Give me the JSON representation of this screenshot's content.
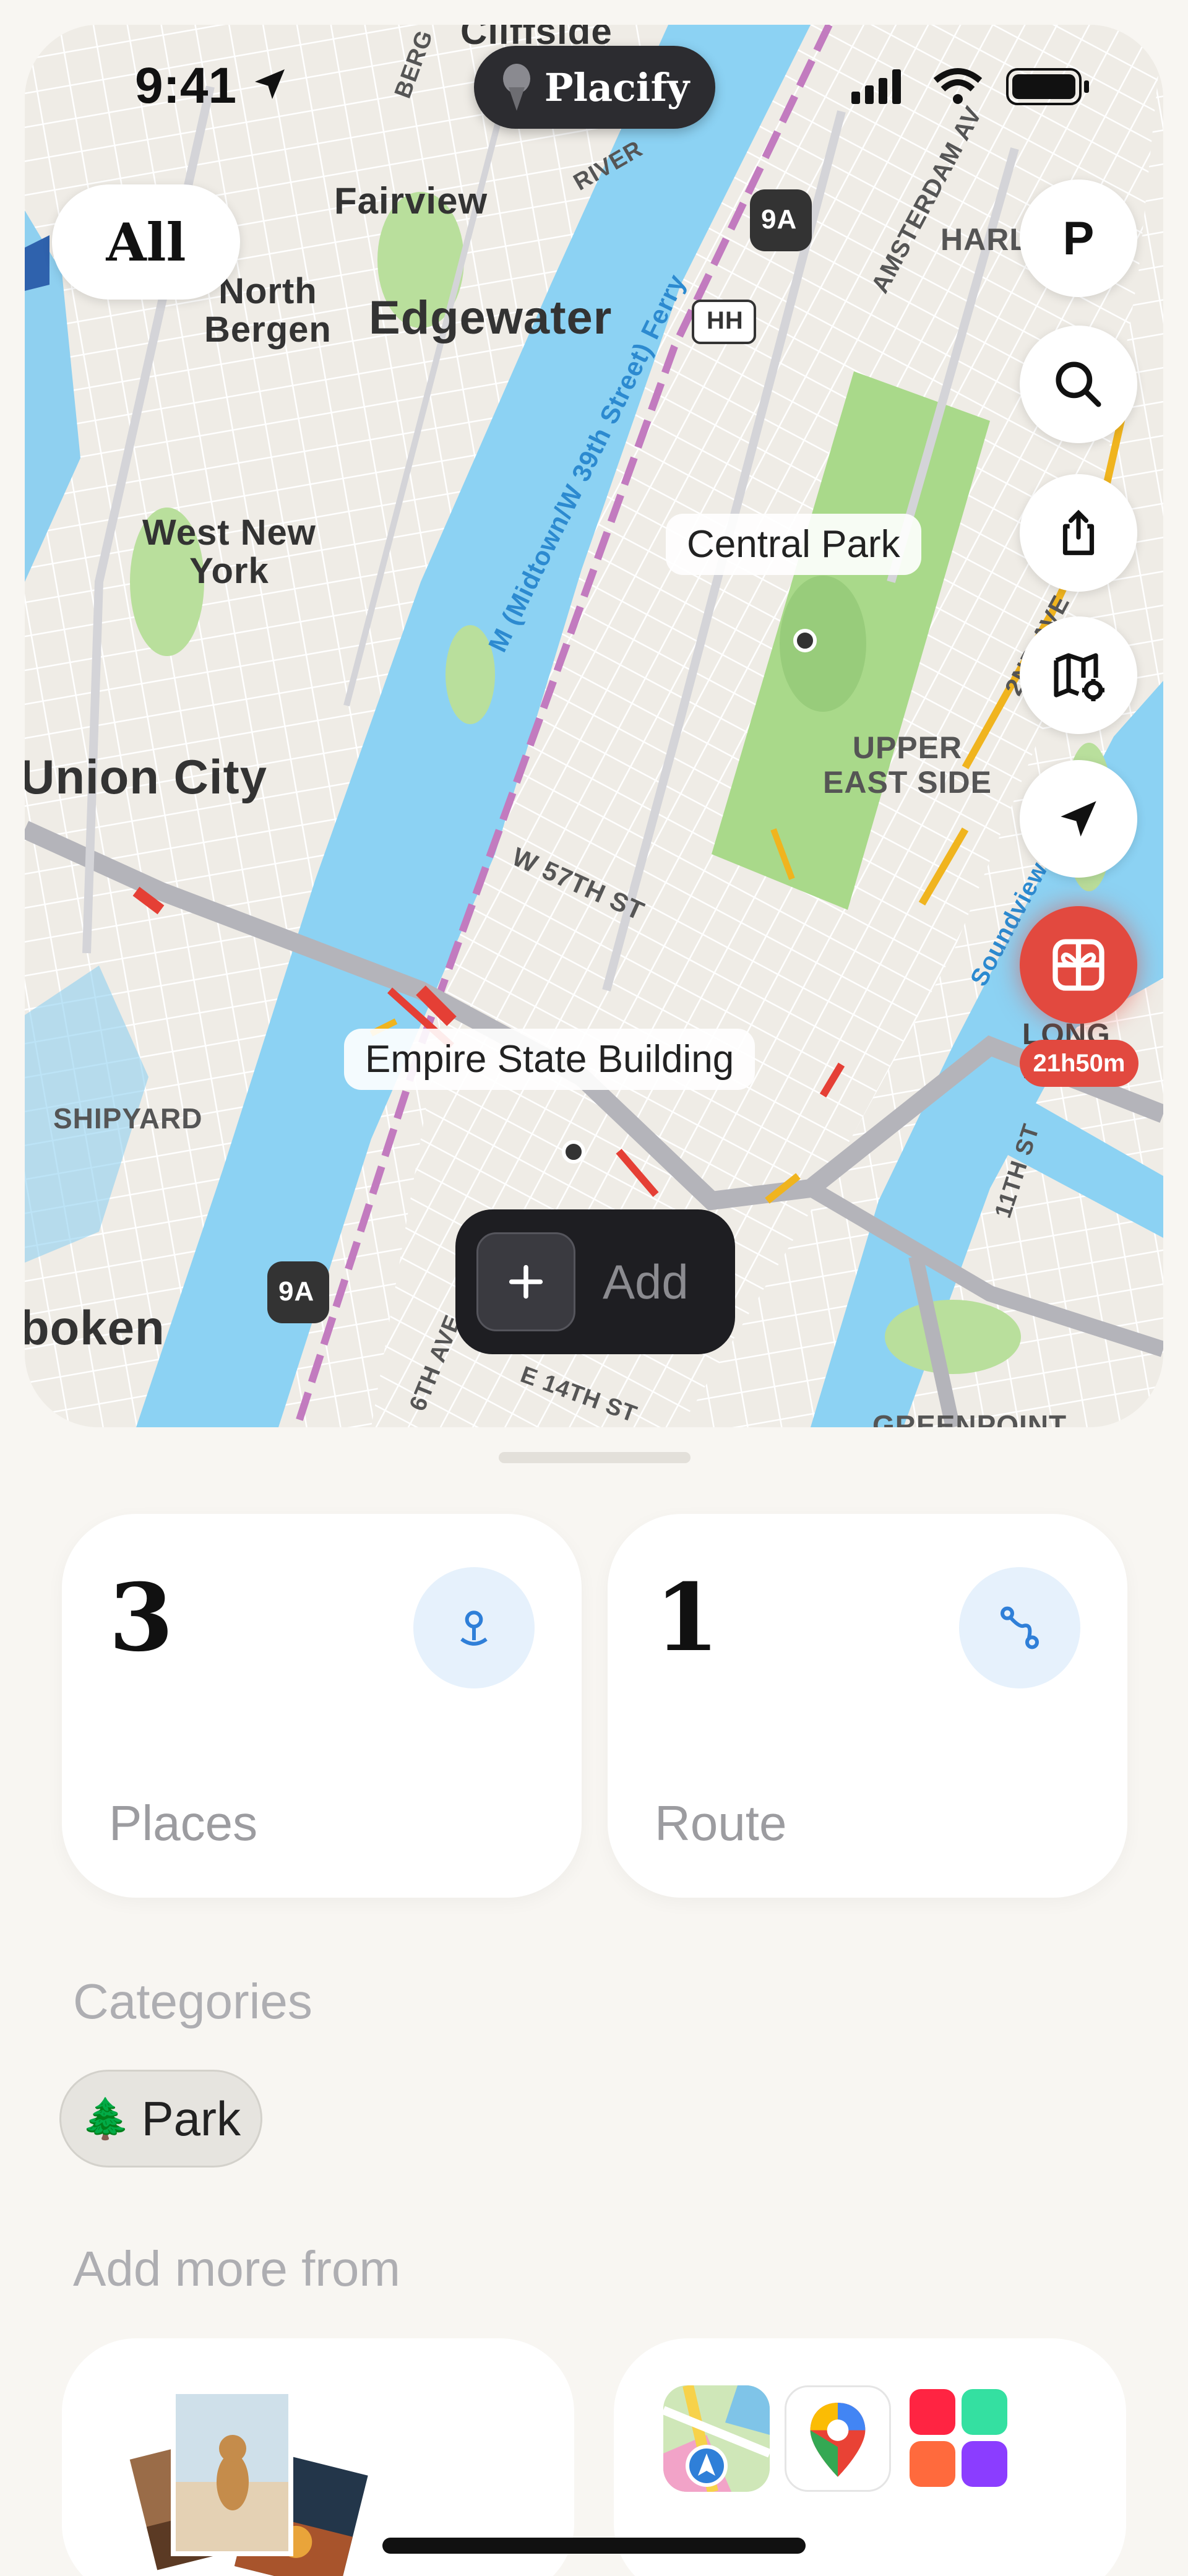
{
  "status": {
    "time": "9:41"
  },
  "brand": {
    "name": "Placify"
  },
  "filter": {
    "label": "All"
  },
  "profile": {
    "initial": "P"
  },
  "map": {
    "labels": {
      "cliffside": "Cliffside",
      "fairview": "Fairview",
      "north_bergen": "North\nBergen",
      "edgewater": "Edgewater",
      "west_new_york": "West New\nYork",
      "union_city": "Union City",
      "shipyard": "SHIPYARD",
      "hoboken": "boken",
      "upper_east_side": "UPPER\nEAST SIDE",
      "w57": "W 57TH ST",
      "harl": "HARL",
      "long_island": "LONG ISLA",
      "greenpoint": "GREENPOINT",
      "ferry": "M (Midtown/W 39th Street) Ferry",
      "amsterdam": "AMSTERDAM AV",
      "second_ave": "2ND AVE",
      "soundview": "Soundview",
      "eleventh": "11TH ST",
      "sixth": "6TH AVE",
      "fourteenth": "E 14TH ST",
      "river": "RIVER",
      "berg": "BERG",
      "route_9a": "9A",
      "route_hh": "HH"
    },
    "places": [
      {
        "name": "Central Park"
      },
      {
        "name": "Empire State Building"
      }
    ],
    "timer": "21h50m",
    "add_label": "Add"
  },
  "stats": [
    {
      "count": "3",
      "label": "Places",
      "icon": "pin-icon"
    },
    {
      "count": "1",
      "label": "Route",
      "icon": "route-icon"
    }
  ],
  "categories": {
    "title": "Categories",
    "items": [
      {
        "emoji": "🌲",
        "label": "Park"
      }
    ]
  },
  "add_more": {
    "title": "Add more from"
  }
}
